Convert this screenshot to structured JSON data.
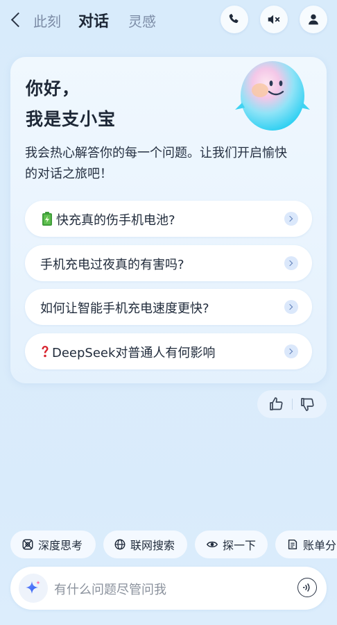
{
  "header": {
    "tabs": [
      {
        "label": "此刻",
        "active": false
      },
      {
        "label": "对话",
        "active": true
      },
      {
        "label": "灵感",
        "active": false
      }
    ],
    "icons": [
      "back-icon",
      "phone-icon",
      "mute-icon",
      "user-icon"
    ]
  },
  "card": {
    "greeting_line1": "你好，",
    "greeting_line2": "我是支小宝",
    "intro_line1": "我会热心解答你的每一个问题。让我们开启愉快",
    "intro_line2": "的对话之旅吧！",
    "questions": [
      {
        "text": "快充真的伤手机电池?",
        "icon": "battery-emoji"
      },
      {
        "text": "手机充电过夜真的有害吗?"
      },
      {
        "text": "如何让智能手机充电速度更快?"
      },
      {
        "text": "DeepSeek对普通人有何影响",
        "icon": "question-mark-emoji"
      }
    ]
  },
  "feedback": {
    "icons": [
      "thumbs-up-icon",
      "thumbs-down-icon"
    ]
  },
  "chips": [
    {
      "label": "深度思考",
      "icon": "deep-think-icon"
    },
    {
      "label": "联网搜索",
      "icon": "globe-icon"
    },
    {
      "label": "探一下",
      "icon": "eye-icon"
    },
    {
      "label": "账单分",
      "icon": "bill-icon"
    }
  ],
  "input": {
    "placeholder": "有什么问题尽管问我"
  },
  "colors": {
    "accent": "#5f7eb8",
    "background": "#d9ebfb",
    "text": "#1f2a3a",
    "muted_tab": "#7b8ba5"
  }
}
